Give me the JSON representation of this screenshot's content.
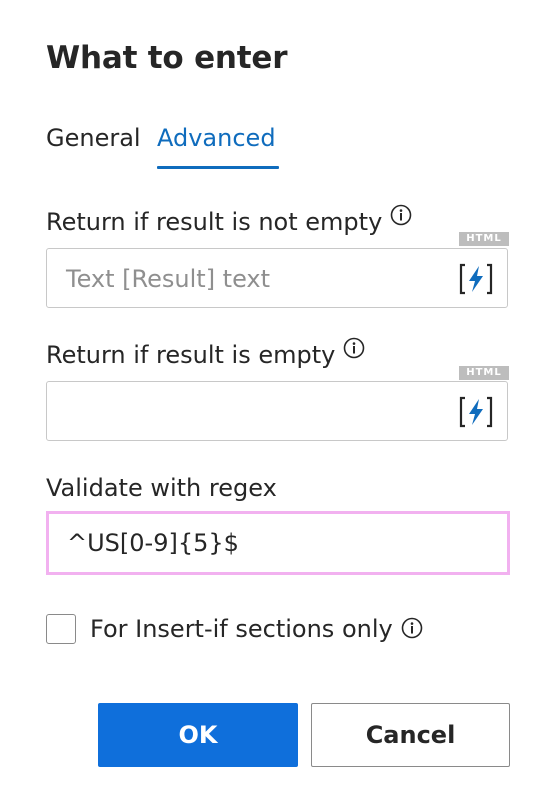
{
  "dialog": {
    "title": "What to enter"
  },
  "tabs": [
    {
      "label": "General",
      "selected": false
    },
    {
      "label": "Advanced",
      "selected": true
    }
  ],
  "fields": {
    "not_empty": {
      "label": "Return if result is not empty",
      "badge": "HTML",
      "value": "",
      "placeholder": "Text [Result] text"
    },
    "empty": {
      "label": "Return if result is empty",
      "badge": "HTML",
      "value": "",
      "placeholder": ""
    },
    "regex": {
      "label": "Validate with regex",
      "value": "^US[0-9]{5}$"
    }
  },
  "checkbox": {
    "label": "For Insert-if sections only",
    "checked": false
  },
  "buttons": {
    "ok": "OK",
    "cancel": "Cancel"
  },
  "colors": {
    "accent": "#0f6cbd",
    "primary_button": "#0f6fdb",
    "regex_focus_border": "#f2b1f0",
    "badge": "#bdbdbd"
  },
  "icons": {
    "info": "info-icon",
    "dynamic_value": "lightning-bracket-icon"
  }
}
